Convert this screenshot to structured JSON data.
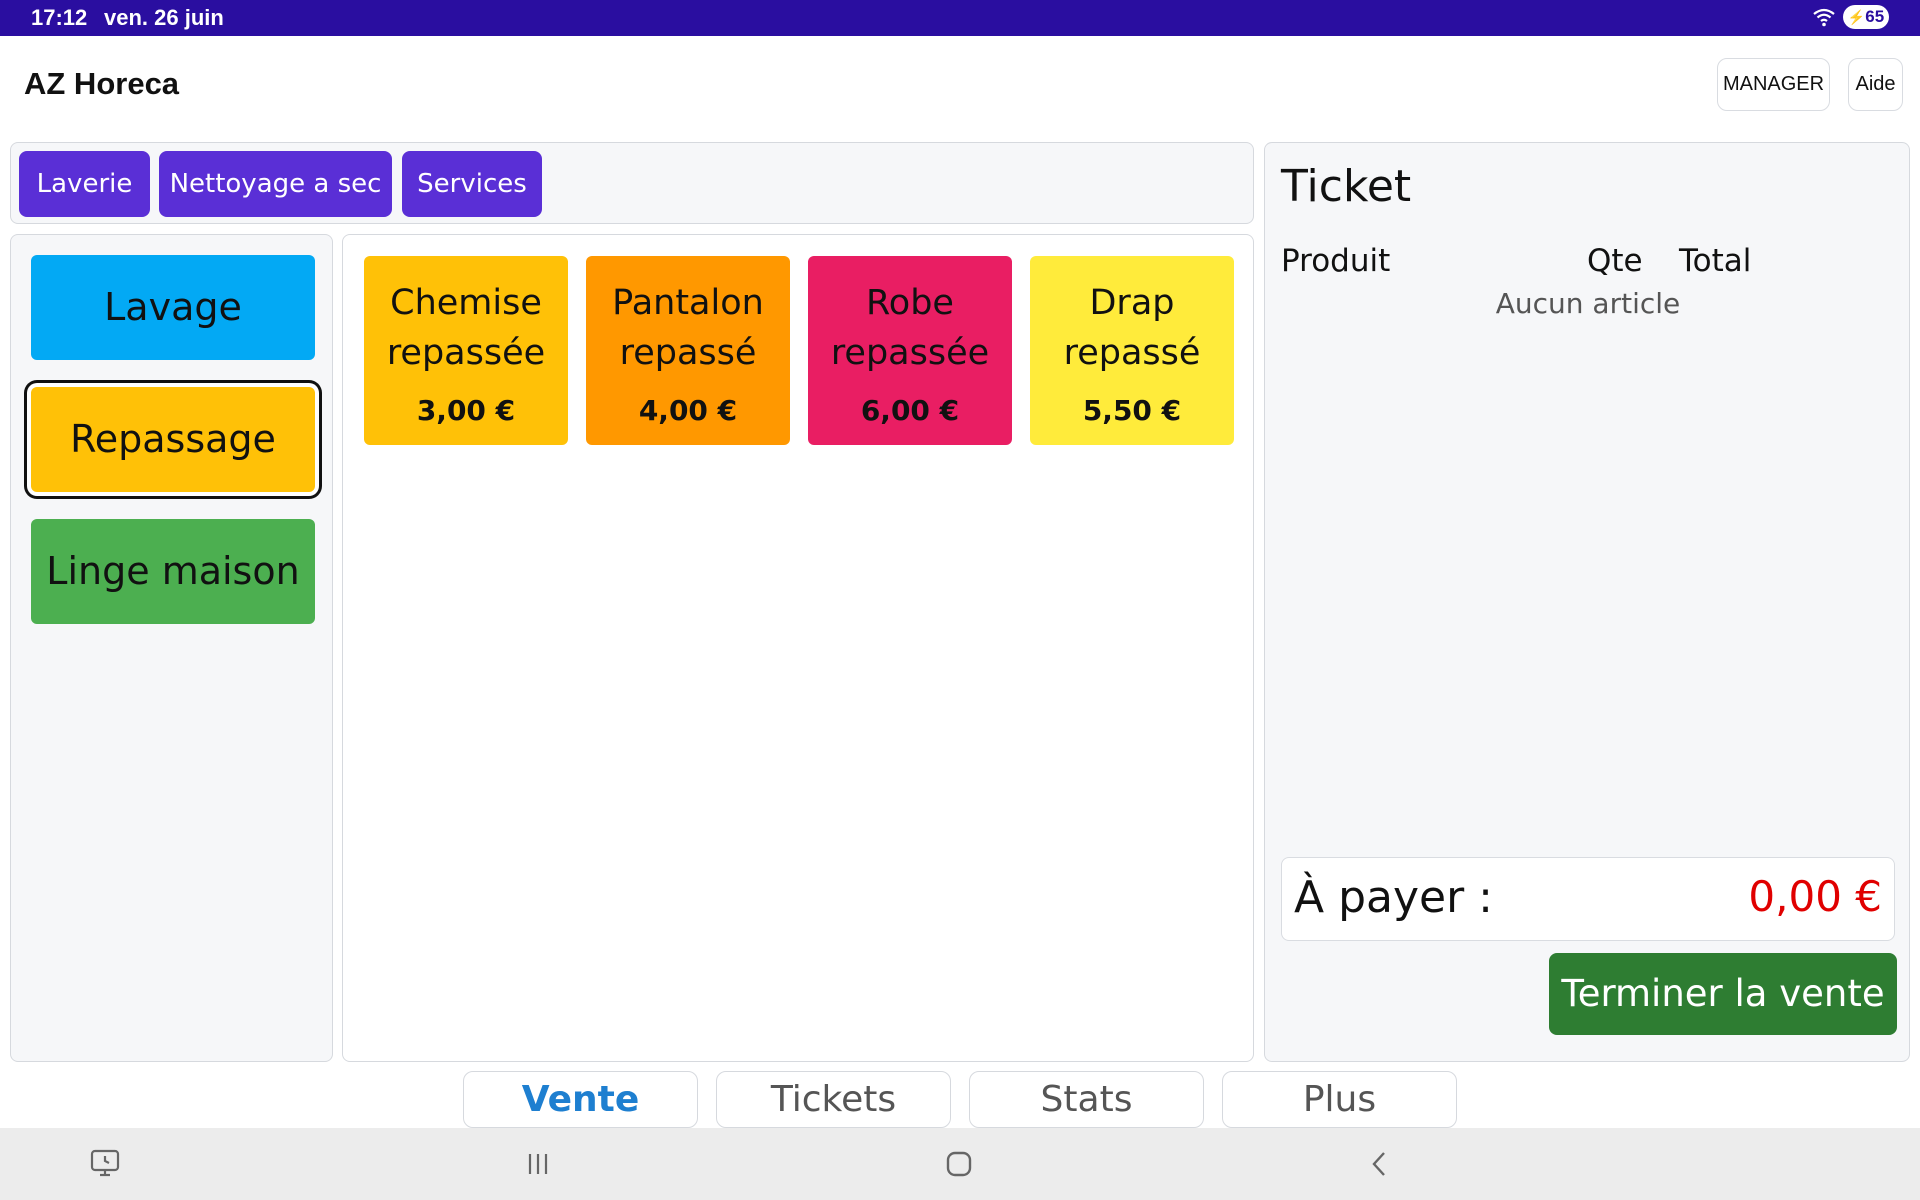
{
  "status_bar": {
    "time": "17:12",
    "date": "ven. 26 juin",
    "battery": "65"
  },
  "header": {
    "title": "AZ Horeca",
    "manager_label": "MANAGER",
    "aide_label": "Aide"
  },
  "categories": [
    {
      "label": "Laverie"
    },
    {
      "label": "Nettoyage a sec"
    },
    {
      "label": "Services"
    }
  ],
  "subcategories": [
    {
      "label": "Lavage",
      "color": "#03a9f4"
    },
    {
      "label": "Repassage",
      "color": "#ffc107",
      "selected": true
    },
    {
      "label": "Linge maison",
      "color": "#4caf50"
    }
  ],
  "products": [
    {
      "line1": "Chemise",
      "line2": "repassée",
      "price": "3,00 €",
      "color": "#ffc107"
    },
    {
      "line1": "Pantalon",
      "line2": "repassé",
      "price": "4,00 €",
      "color": "#ff9800"
    },
    {
      "line1": "Robe",
      "line2": "repassée",
      "price": "6,00 €",
      "color": "#e91e63"
    },
    {
      "line1": "Drap",
      "line2": "repassé",
      "price": "5,50 €",
      "color": "#ffeb3b"
    }
  ],
  "ticket": {
    "title": "Ticket",
    "col_product": "Produit",
    "col_qty": "Qte",
    "col_total": "Total",
    "empty_message": "Aucun article",
    "pay_label": "À payer :",
    "pay_amount": "0,00 €",
    "finish_label": "Terminer la vente"
  },
  "tabs": [
    {
      "label": "Vente",
      "active": true
    },
    {
      "label": "Tickets"
    },
    {
      "label": "Stats"
    },
    {
      "label": "Plus"
    }
  ],
  "colors": {
    "status_bar": "#2a0ea0",
    "category_button": "#5a2fd6",
    "finish_button": "#2e7d32",
    "amount": "#e00000",
    "active_tab": "#1e7fd0"
  },
  "icons": {
    "status": [
      "wifi-icon",
      "battery-icon"
    ],
    "nav": [
      "recent-screen-icon",
      "recent-apps-icon",
      "home-icon",
      "back-icon"
    ]
  }
}
